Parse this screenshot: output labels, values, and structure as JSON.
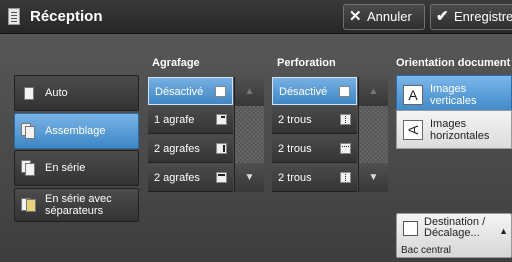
{
  "header": {
    "title": "Réception",
    "cancel_label": "Annuler",
    "save_label": "Enregistrer"
  },
  "groups": {
    "stapling": "Agrafage",
    "punching": "Perforation",
    "orientation": "Orientation document"
  },
  "modes": [
    {
      "label": "Auto",
      "selected": false
    },
    {
      "label": "Assemblage",
      "selected": true
    },
    {
      "label": "En série",
      "selected": false
    },
    {
      "label": "En série avec séparateurs",
      "selected": false
    }
  ],
  "stapling_options": [
    {
      "label": "Désactivé",
      "selected": true
    },
    {
      "label": "1 agrafe",
      "selected": false
    },
    {
      "label": "2 agrafes",
      "selected": false
    },
    {
      "label": "2 agrafes",
      "selected": false
    }
  ],
  "punching_options": [
    {
      "label": "Désactivé",
      "selected": true
    },
    {
      "label": "2 trous",
      "selected": false
    },
    {
      "label": "2 trous",
      "selected": false
    },
    {
      "label": "2 trous",
      "selected": false
    }
  ],
  "orientation_options": [
    {
      "label": "Images verticales",
      "icon_letter": "A",
      "selected": true
    },
    {
      "label": "Images horizontales",
      "icon_letter": "A",
      "selected": false
    }
  ],
  "destination": {
    "label": "Destination / Décalage...",
    "value": "Bac central"
  },
  "colors": {
    "selected": "#4a90d0",
    "background": "#4a4a4a"
  }
}
